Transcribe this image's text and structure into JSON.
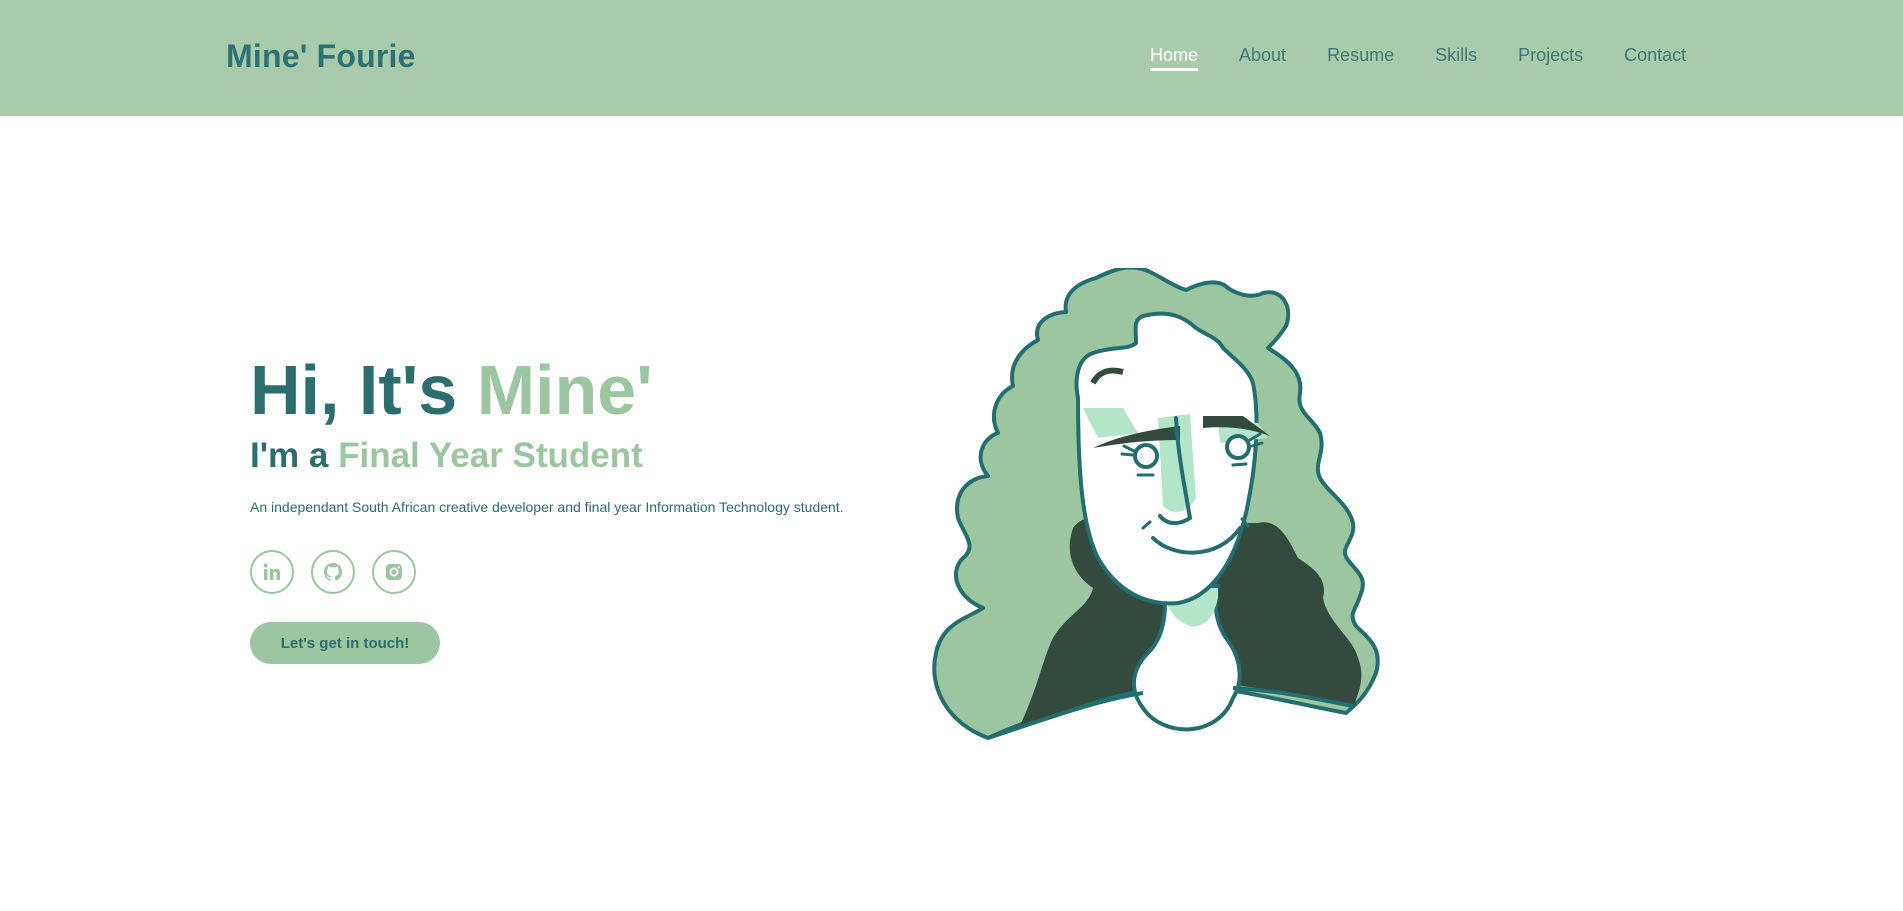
{
  "header": {
    "logo": "Mine' Fourie",
    "nav": [
      {
        "label": "Home",
        "active": true
      },
      {
        "label": "About",
        "active": false
      },
      {
        "label": "Resume",
        "active": false
      },
      {
        "label": "Skills",
        "active": false
      },
      {
        "label": "Projects",
        "active": false
      },
      {
        "label": "Contact",
        "active": false
      }
    ]
  },
  "hero": {
    "greeting_prefix": "Hi, It's ",
    "greeting_name": "Mine'",
    "role_prefix": "I'm a ",
    "role": "Final Year Student",
    "description": "An independant South African creative developer and final year Information Technology student.",
    "socials": [
      {
        "icon": "linkedin-icon"
      },
      {
        "icon": "github-icon"
      },
      {
        "icon": "instagram-icon"
      }
    ],
    "cta_label": "Let's get in touch!"
  },
  "colors": {
    "header_bg": "#a7cbab",
    "primary": "#2b6e6d",
    "accent": "#9cc6a0",
    "dark_green": "#324b3e",
    "light_mint": "#b3e6c8"
  }
}
